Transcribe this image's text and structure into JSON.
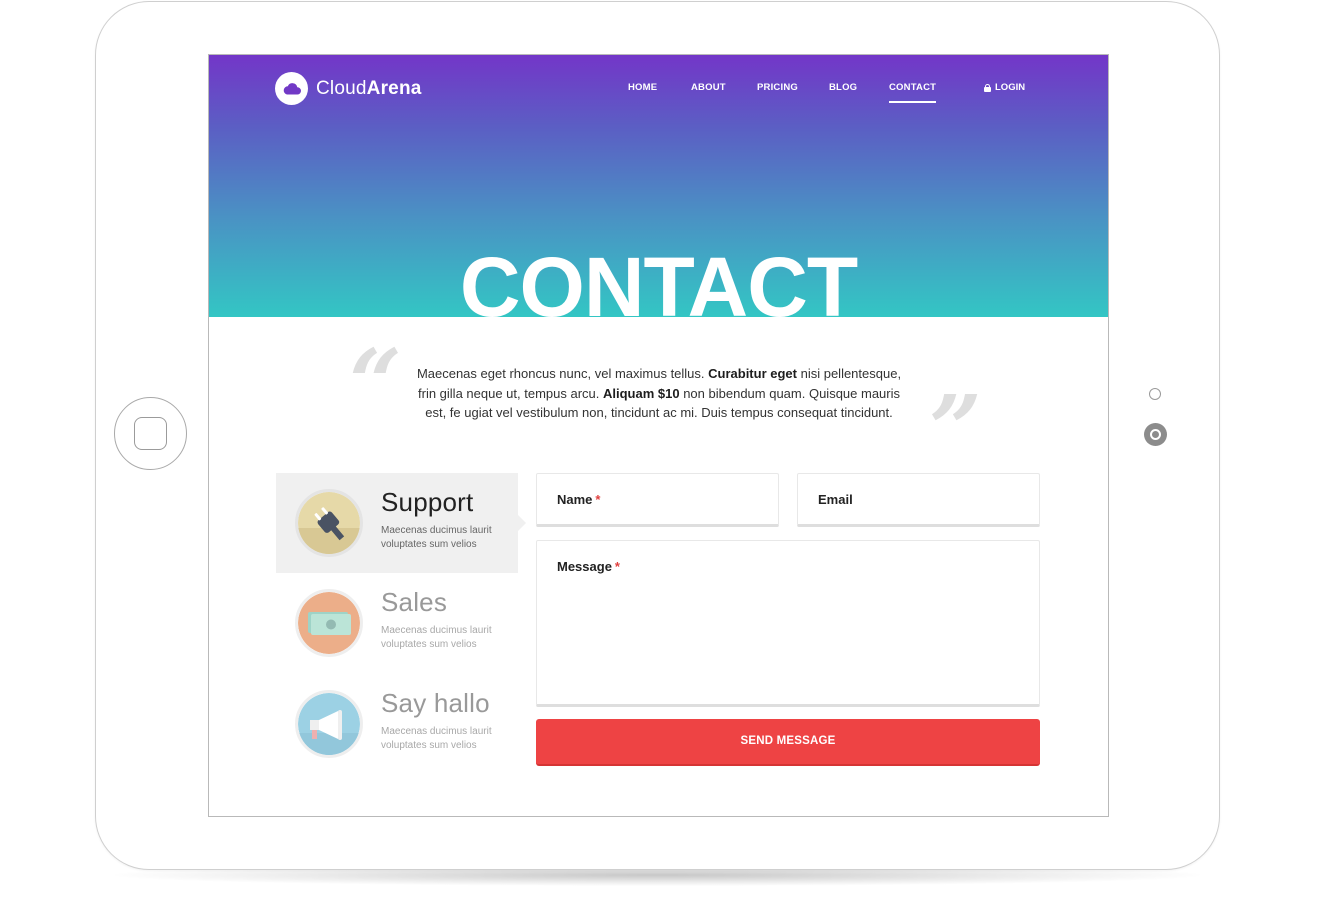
{
  "brand": {
    "name_light": "Cloud",
    "name_bold": "Arena"
  },
  "nav": {
    "items": [
      {
        "label": "HOME"
      },
      {
        "label": "ABOUT"
      },
      {
        "label": "PRICING"
      },
      {
        "label": "BLOG"
      },
      {
        "label": "CONTACT",
        "active": true
      }
    ],
    "login_label": "LOGIN"
  },
  "hero": {
    "title": "CONTACT"
  },
  "quote": {
    "open_mark": "“",
    "close_mark": "”",
    "part1": "Maecenas eget rhoncus nunc, vel maximus tellus. ",
    "bold1": "Curabitur eget",
    "part2": " nisi pellentesque, frin gilla neque ut, tempus arcu. ",
    "bold2": "Aliquam $10",
    "part3": " non bibendum quam. Quisque mauris est, fe ugiat vel vestibulum non, tincidunt ac mi. Duis tempus consequat tincidunt."
  },
  "cards": [
    {
      "title": "Support",
      "desc": "Maecenas ducimus laurit voluptates sum velios",
      "icon": "plug-icon",
      "active": true
    },
    {
      "title": "Sales",
      "desc": "Maecenas ducimus laurit voluptates sum velios",
      "icon": "money-icon",
      "active": false
    },
    {
      "title": "Say hallo",
      "desc": "Maecenas ducimus laurit voluptates sum velios",
      "icon": "megaphone-icon",
      "active": false
    }
  ],
  "form": {
    "name_label": "Name",
    "email_label": "Email",
    "message_label": "Message",
    "required_mark": "*",
    "submit_label": "SEND MESSAGE"
  },
  "colors": {
    "gradient_top": "#7336c8",
    "gradient_bottom": "#33c6c4",
    "accent_red": "#ee4344"
  }
}
